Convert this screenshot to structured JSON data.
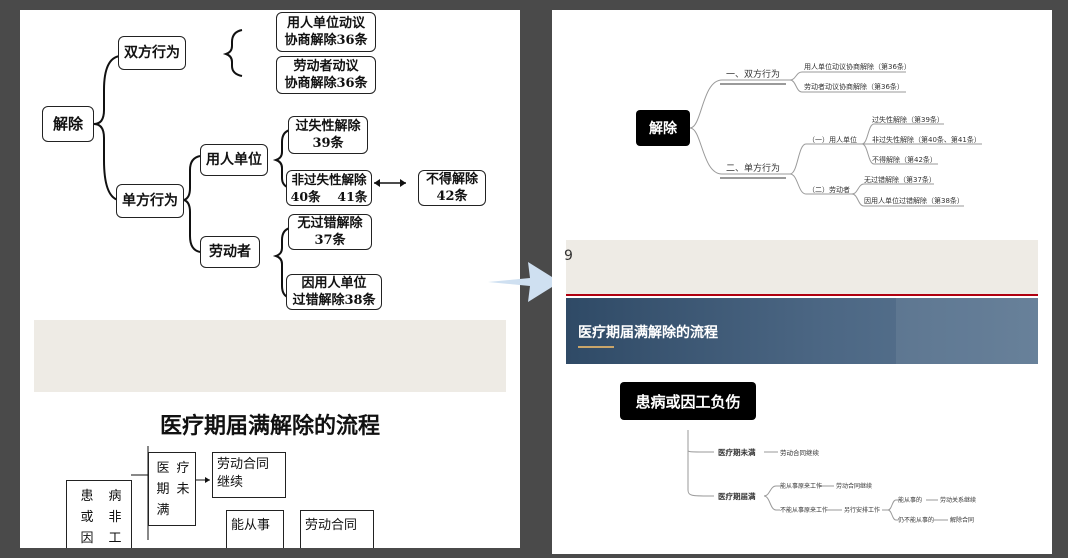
{
  "left": {
    "mindmap": {
      "root": "解除",
      "bilateral": "双方行为",
      "bilateral_items": [
        {
          "line1": "用人单位动议",
          "line2": "协商解除36条"
        },
        {
          "line1": "劳动者动议",
          "line2": "协商解除36条"
        }
      ],
      "unilateral": "单方行为",
      "employer": "用人单位",
      "fault_l1": "过失性解除",
      "fault_l2": "39条",
      "nonfault_l1": "非过失性解除",
      "nonfault_l2": "40条　 41条",
      "prohibit_l1": "不得解除",
      "prohibit_l2": "42条",
      "worker": "劳动者",
      "nofault_l1": "无过错解除",
      "nofault_l2": "37条",
      "employer_fault_l1": "因用人单位",
      "employer_fault_l2": "过错解除38条"
    },
    "flow_title": "医疗期届满解除的流程",
    "flow": {
      "patient": [
        "患",
        "病",
        "或",
        "非",
        "因",
        "工"
      ],
      "medical": [
        "医",
        "疗",
        "期",
        "未",
        "满"
      ],
      "continue_l1": "劳动合同",
      "continue_l2": "继续",
      "can_work": "能从事",
      "contract2": "劳动合同"
    }
  },
  "right": {
    "mindmap": {
      "root": "解除",
      "bilateral": "一、双方行为",
      "bilateral_items": [
        "用人单位动议协商解除（第36条）",
        "劳动者动议协商解除（第36条）"
      ],
      "unilateral": "二、单方行为",
      "employer": "（一）用人单位",
      "employer_items": [
        "过失性解除（第39条）",
        "非过失性解除（第40条、第41条）",
        "不得解除（第42条）"
      ],
      "worker": "（二）劳动者",
      "worker_items": [
        "无过错解除（第37条）",
        "因用人单位过错解除（第38条）"
      ]
    },
    "slide_number": "9",
    "banner_title": "医疗期届满解除的流程",
    "flow": {
      "root": "患病或因工负伤",
      "unexpired": "医疗期未满",
      "unexpired_result": "劳动合同继续",
      "expired": "医疗期届满",
      "can_original": "能从事原来工作",
      "can_original_result": "劳动合同继续",
      "cannot_original": "不能从事原来工作",
      "reassign": "另行安排工作",
      "can_do": "能从事的",
      "can_do_result": "劳动关系继续",
      "cannot_do": "仍不能从事的",
      "cannot_do_result": "解除合同"
    }
  },
  "arrow_color": "#cfe0f1"
}
